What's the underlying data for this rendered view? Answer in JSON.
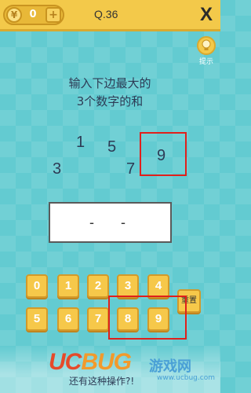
{
  "header": {
    "coin_icon_text": "¥",
    "coins": "0",
    "add_icon_text": "+",
    "level": "Q.36",
    "close_label": "X"
  },
  "hint": {
    "label": "提示",
    "icon": "lightbulb-icon"
  },
  "question": {
    "line1": "输入下边最大的",
    "line2": "3个数字的和"
  },
  "puzzle_numbers": [
    "1",
    "5",
    "9",
    "3",
    "7"
  ],
  "answer": {
    "slot1": "-",
    "slot2": "-"
  },
  "keypad": {
    "row1": [
      "0",
      "1",
      "2",
      "3",
      "4"
    ],
    "row2": [
      "5",
      "6",
      "7",
      "8",
      "9"
    ],
    "reset_label": "重置"
  },
  "footer": {
    "text": "还有这种操作?!"
  },
  "watermark": {
    "logo_uc": "UC",
    "logo_bug": "BUG",
    "site_name": "游戏网",
    "url": "www.ucbug.com"
  },
  "colors": {
    "background": "#63cbd1",
    "topbar": "#f3c94a",
    "key": "#f6c84a",
    "highlight_box": "#e0201b",
    "text": "#2d3b55"
  }
}
